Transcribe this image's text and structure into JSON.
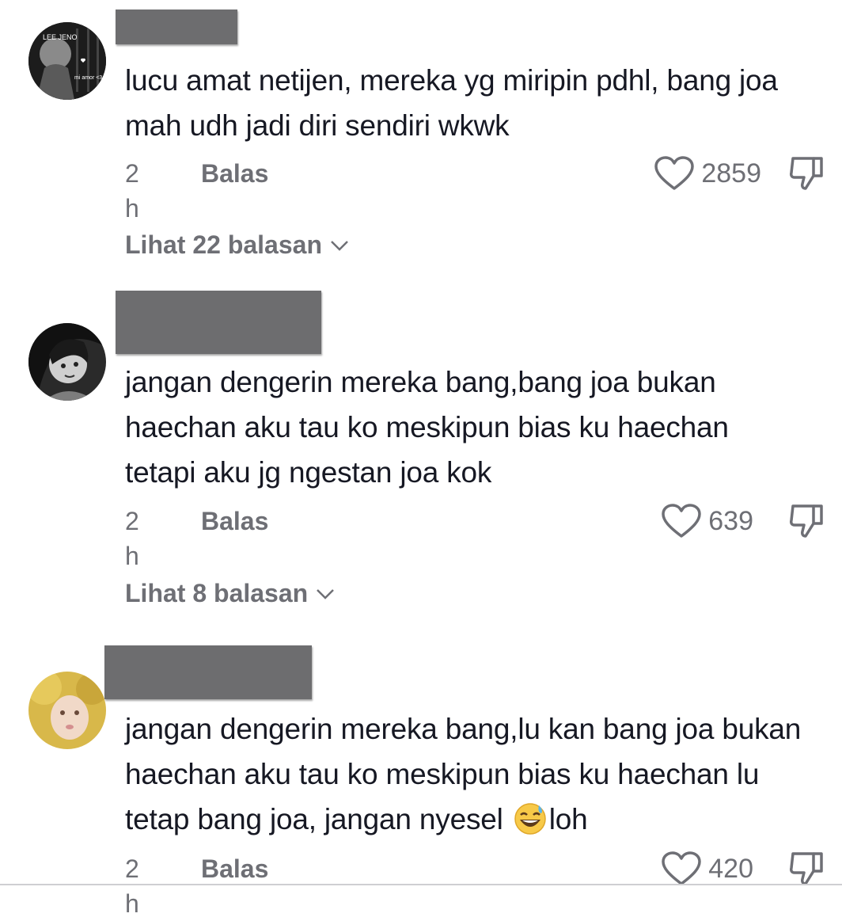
{
  "comments": [
    {
      "text": "lucu amat netijen, mereka yg miripin pdhl, bang joa mah udh jadi diri sendiri wkwk",
      "time": "2 h",
      "reply_label": "Balas",
      "likes": "2859",
      "view_replies": "Lihat 22 balasan",
      "avatar_text": [
        "LEE JENO",
        "mi amor <3"
      ]
    },
    {
      "text": "jangan dengerin mereka bang,bang joa bukan haechan aku tau ko meskipun bias ku haechan tetapi aku jg ngestan joa kok",
      "time": "2 h",
      "reply_label": "Balas",
      "likes": "639",
      "view_replies": "Lihat 8 balasan"
    },
    {
      "text_before_emoji": "jangan dengerin mereka bang,lu kan bang joa bukan haechan aku tau ko meskipun bias ku haechan lu tetap bang joa, jangan nyesel ",
      "emoji": "grinning-face-with-sweat",
      "text_after_emoji": "loh",
      "time": "2 h",
      "reply_label": "Balas",
      "likes": "420"
    }
  ],
  "icons": {
    "like": "heart-outline-icon",
    "dislike": "thumbs-down-icon",
    "expand": "chevron-down-icon"
  },
  "colors": {
    "text": "#161823",
    "muted": "#6e6f75",
    "redaction": "#6d6d6f"
  }
}
